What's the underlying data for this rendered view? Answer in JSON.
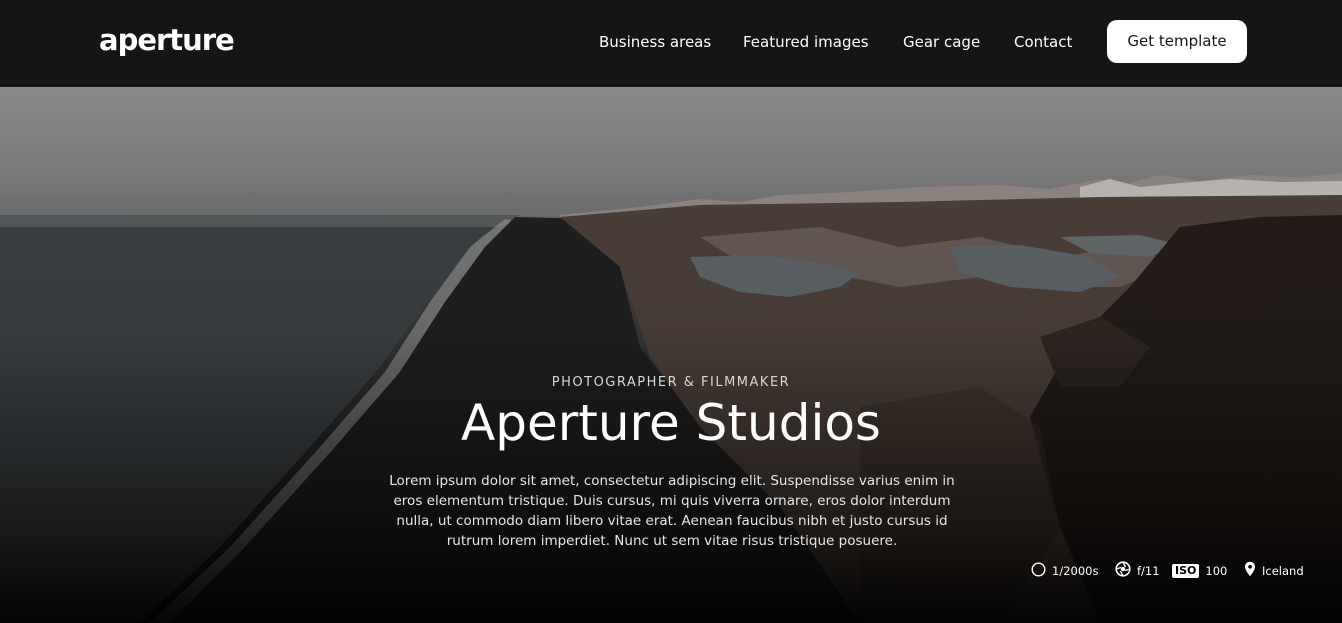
{
  "header": {
    "logo": "aperture",
    "nav": [
      "Business areas",
      "Featured images",
      "Gear cage",
      "Contact"
    ],
    "cta_label": "Get template"
  },
  "hero": {
    "eyebrow": "PHOTOGRAPHER & FILMMAKER",
    "title": "Aperture Studios",
    "description": "Lorem ipsum dolor sit amet, consectetur adipiscing elit. Suspendisse varius enim in eros elementum tristique. Duis cursus, mi quis viverra ornare, eros dolor interdum nulla, ut commodo diam libero vitae erat. Aenean faucibus nibh et justo cursus id rutrum lorem imperdiet. Nunc ut sem vitae risus tristique posuere."
  },
  "specs": {
    "shutter": {
      "icon": "shutter-speed-icon",
      "value": "1/2000s"
    },
    "aperture": {
      "icon": "aperture-icon",
      "value": "f/11"
    },
    "iso": {
      "icon": "iso-icon",
      "badge": "ISO",
      "value": "100"
    },
    "location": {
      "icon": "location-pin-icon",
      "value": "Iceland"
    }
  },
  "colors": {
    "header_bg": "#151515",
    "cta_bg": "#ffffff",
    "cta_text": "#161616"
  }
}
